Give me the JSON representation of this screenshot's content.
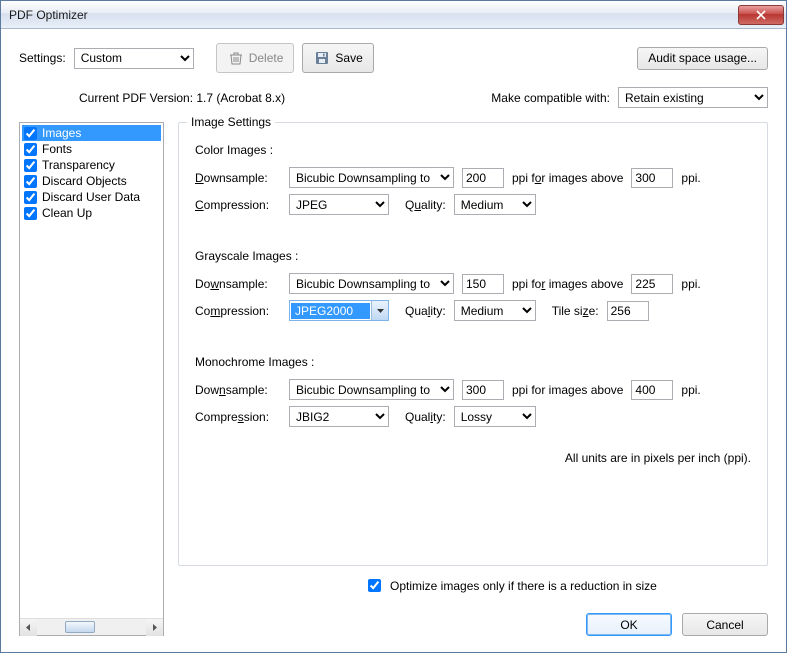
{
  "window": {
    "title": "PDF Optimizer"
  },
  "toolbar": {
    "settings_label": "Settings:",
    "settings_value": "Custom",
    "delete": "Delete",
    "save": "Save",
    "audit": "Audit space usage..."
  },
  "info": {
    "version": "Current PDF Version: 1.7 (Acrobat 8.x)",
    "compat_label": "Make compatible with:",
    "compat_value": "Retain existing"
  },
  "sidebar": {
    "items": [
      {
        "label": "Images",
        "checked": true,
        "selected": true
      },
      {
        "label": "Fonts",
        "checked": true,
        "selected": false
      },
      {
        "label": "Transparency",
        "checked": true,
        "selected": false
      },
      {
        "label": "Discard Objects",
        "checked": true,
        "selected": false
      },
      {
        "label": "Discard User Data",
        "checked": true,
        "selected": false
      },
      {
        "label": "Clean Up",
        "checked": true,
        "selected": false
      }
    ]
  },
  "panel": {
    "legend": "Image Settings",
    "color": {
      "title": "Color Images :",
      "downsample_label": "Downsample:",
      "downsample_method": "Bicubic Downsampling to",
      "ppi": "200",
      "above_label": "ppi for images above",
      "above": "300",
      "ppi_suffix": "ppi.",
      "compression_label": "Compression:",
      "compression": "JPEG",
      "quality_label": "Quality:",
      "quality": "Medium"
    },
    "gray": {
      "title": "Grayscale Images :",
      "downsample_label": "Downsample:",
      "downsample_method": "Bicubic Downsampling to",
      "ppi": "150",
      "above_label": "ppi for images above",
      "above": "225",
      "ppi_suffix": "ppi.",
      "compression_label": "Compression:",
      "compression": "JPEG2000",
      "quality_label": "Quality:",
      "quality": "Medium",
      "tile_label": "Tile size:",
      "tile": "256"
    },
    "mono": {
      "title": "Monochrome Images :",
      "downsample_label": "Downsample:",
      "downsample_method": "Bicubic Downsampling to",
      "ppi": "300",
      "above_label": "ppi for images above",
      "above": "400",
      "ppi_suffix": "ppi.",
      "compression_label": "Compression:",
      "compression": "JBIG2",
      "quality_label": "Quality:",
      "quality": "Lossy"
    },
    "note": "All units are in pixels per inch (ppi)."
  },
  "optimize": {
    "checked": true,
    "label": "Optimize images only if there is a reduction in size"
  },
  "footer": {
    "ok": "OK",
    "cancel": "Cancel"
  }
}
